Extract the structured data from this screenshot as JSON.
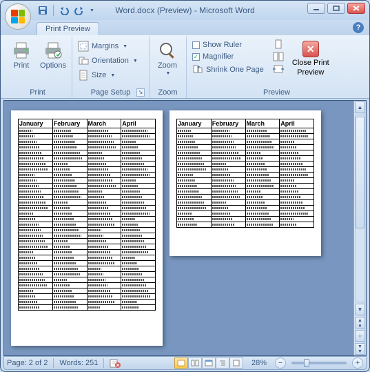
{
  "window": {
    "title": "Word.docx (Preview) - Microsoft Word"
  },
  "qat": {
    "save": "save-icon",
    "undo": "undo-icon",
    "redo": "redo-icon"
  },
  "tab": {
    "label": "Print Preview"
  },
  "ribbon": {
    "print_group": {
      "label": "Print",
      "print": "Print",
      "options": "Options"
    },
    "page_setup_group": {
      "label": "Page Setup",
      "margins": "Margins",
      "orientation": "Orientation",
      "size": "Size"
    },
    "zoom_group": {
      "label": "Zoom",
      "zoom": "Zoom"
    },
    "preview_group": {
      "label": "Preview",
      "show_ruler": "Show Ruler",
      "show_ruler_checked": false,
      "magnifier": "Magnifier",
      "magnifier_checked": true,
      "shrink": "Shrink One Page",
      "close_l1": "Close Print",
      "close_l2": "Preview"
    }
  },
  "doc": {
    "headers": [
      "January",
      "February",
      "March",
      "April"
    ],
    "page1_rows": 33,
    "page2_rows": 18
  },
  "status": {
    "page": "Page: 2 of 2",
    "words": "Words: 251",
    "zoom_pct": "28%"
  }
}
